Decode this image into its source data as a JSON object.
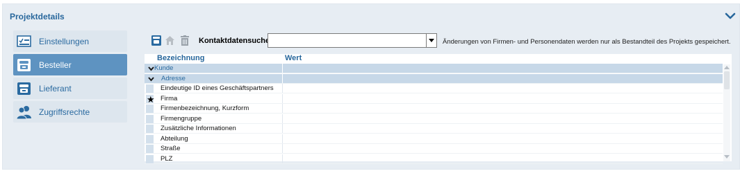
{
  "panel": {
    "title": "Projektdetails",
    "collapse_icon": "chevron-down-icon"
  },
  "nav": {
    "items": [
      {
        "label": "Einstellungen",
        "icon": "settings-checklist-icon",
        "active": false
      },
      {
        "label": "Besteller",
        "icon": "phone-icon",
        "active": true
      },
      {
        "label": "Lieferant",
        "icon": "phone-icon",
        "active": false
      },
      {
        "label": "Zugriffsrechte",
        "icon": "users-icon",
        "active": false
      }
    ]
  },
  "toolbar": {
    "icons": [
      "phone-icon",
      "home-icon",
      "trash-icon"
    ],
    "search_label": "Kontaktdatensuche",
    "search_value": "",
    "notice": "Änderungen von Firmen- und Personendaten werden nur als Bestandteil des Projekts gespeichert."
  },
  "grid": {
    "columns": [
      "Bezeichnung",
      "Wert"
    ],
    "rows": [
      {
        "name": "Kunde",
        "group": true,
        "level": 0,
        "value": ""
      },
      {
        "name": "Adresse",
        "group": true,
        "level": 1,
        "value": ""
      },
      {
        "name": "Eindeutige ID eines Geschäftspartners",
        "group": false,
        "value": ""
      },
      {
        "name": "Firma",
        "group": false,
        "required": true,
        "value": ""
      },
      {
        "name": "Firmenbezeichnung, Kurzform",
        "group": false,
        "value": ""
      },
      {
        "name": "Firmengruppe",
        "group": false,
        "value": ""
      },
      {
        "name": "Zusätzliche Informationen",
        "group": false,
        "value": ""
      },
      {
        "name": "Abteilung",
        "group": false,
        "value": ""
      },
      {
        "name": "Straße",
        "group": false,
        "value": ""
      },
      {
        "name": "PLZ",
        "group": false,
        "value": ""
      }
    ]
  },
  "colors": {
    "accent": "#28679c",
    "active_nav": "#5e93c1",
    "panel_bg": "#e7edf3",
    "group_row": "#c7d8e8"
  }
}
